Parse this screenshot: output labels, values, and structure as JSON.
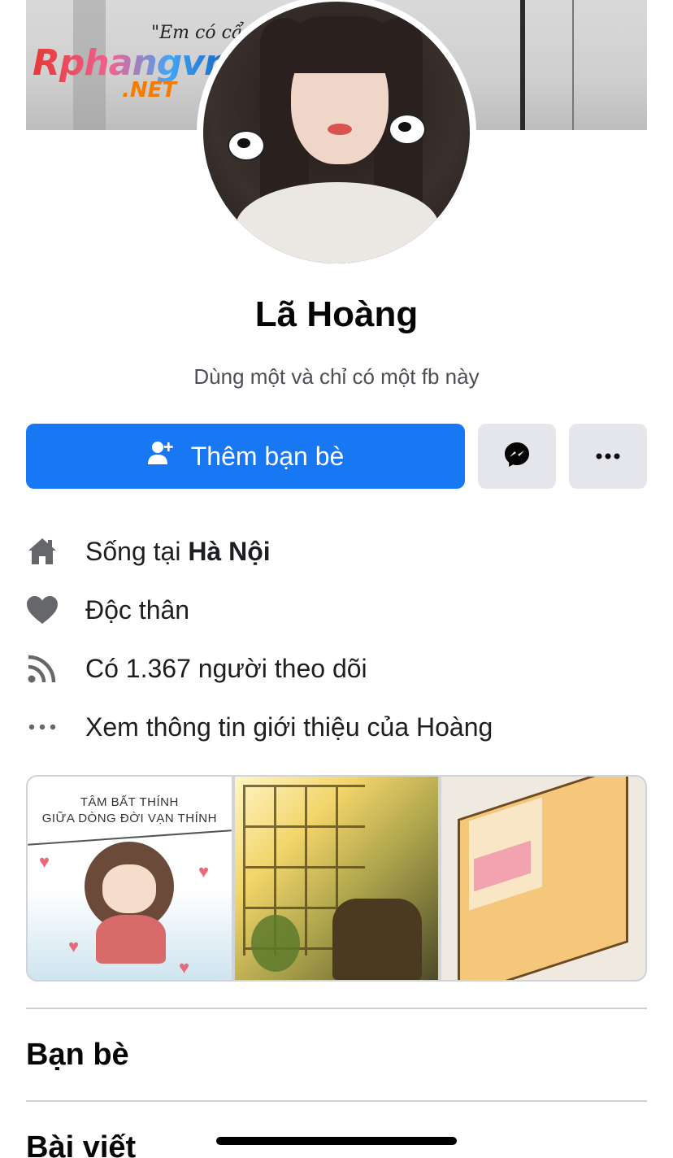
{
  "cover": {
    "quote": "\"Em có cẩ",
    "watermark_main": "Rphangvn",
    "watermark_tld": ".NET"
  },
  "profile": {
    "name": "Lã Hoàng",
    "bio": "Dùng một và chỉ có một fb này"
  },
  "actions": {
    "add_friend_label": "Thêm bạn bè",
    "messenger_icon": "messenger-icon",
    "more_icon": "more-horizontal-icon"
  },
  "info": {
    "lives_prefix": "Sống tại ",
    "lives_city": "Hà Nội",
    "relationship": "Độc thân",
    "followers": "Có 1.367 người theo dõi",
    "about": "Xem thông tin giới thiệu của Hoàng"
  },
  "photos": {
    "photo1_caption_line1": "TÂM BẤT THÍNH",
    "photo1_caption_line2": "GIỮA DÒNG ĐỜI VẠN THÍNH"
  },
  "sections": {
    "friends": "Bạn bè",
    "posts": "Bài viết"
  },
  "colors": {
    "primary": "#1877f2",
    "secondary_button": "#e4e6eb",
    "icon_gray": "#65676b"
  }
}
